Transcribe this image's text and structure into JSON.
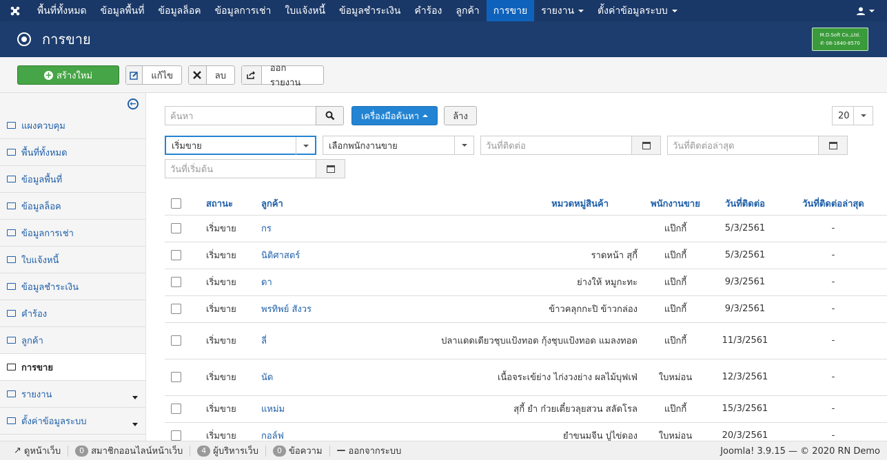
{
  "nav": {
    "items": [
      "พื้นที่ทั้งหมด",
      "ข้อมูลพื้นที่",
      "ข้อมูลล็อค",
      "ข้อมูลการเช่า",
      "ใบแจ้งหนี้",
      "ข้อมูลชำระเงิน",
      "คำร้อง",
      "ลูกค้า",
      "การขาย",
      "รายงาน",
      "ตั้งค่าข้อมูลระบบ"
    ],
    "active": "การขาย"
  },
  "header": {
    "title": "การขาย",
    "brand_line1": "M.D.Soft Co.,Ltd.",
    "brand_line2": "08-1640-8570"
  },
  "toolbar": {
    "new": "สร้างใหม่",
    "edit": "แก้ไข",
    "delete": "ลบ",
    "export": "ออกรายงาน"
  },
  "sidebar": {
    "items": [
      "แผงควบคุม",
      "พื้นที่ทั้งหมด",
      "ข้อมูลพื้นที่",
      "ข้อมูลล็อค",
      "ข้อมูลการเช่า",
      "ใบแจ้งหนี้",
      "ข้อมูลชำระเงิน",
      "คำร้อง",
      "ลูกค้า",
      "การขาย",
      "รายงาน",
      "ตั้งค่าข้อมูลระบบ"
    ]
  },
  "filters": {
    "search_placeholder": "ค้นหา",
    "tools": "เครื่องมือค้นหา",
    "clear": "ล้าง",
    "limit": "20",
    "status": "เริ่มขาย",
    "employee": "เลือกพนักงานขาย",
    "contact_date": "วันที่ติดต่อ",
    "last_contact": "วันที่ติดต่อล่าสุด",
    "start_date": "วันที่เริ่มต้น"
  },
  "table": {
    "headers": [
      "สถานะ",
      "ลูกค้า",
      "หมวดหมู่สินค้า",
      "พนักงานขาย",
      "วันที่ติดต่อ",
      "วันที่ติดต่อล่าสุด"
    ],
    "rows": [
      [
        "เริ่มขาย",
        "กร",
        "",
        "แป๊กกี้",
        "5/3/2561",
        "-"
      ],
      [
        "เริ่มขาย",
        "นิติศาสตร์",
        "ราดหน้า สุกี้",
        "แป๊กกี้",
        "5/3/2561",
        "-"
      ],
      [
        "เริ่มขาย",
        "ดา",
        "ย่างให้ หมูกะทะ",
        "แป๊กกี้",
        "9/3/2561",
        "-"
      ],
      [
        "เริ่มขาย",
        "พรทิพย์ สังวร",
        "ข้าวคลุกกะปิ ข้าวกล่อง",
        "แป๊กกี้",
        "9/3/2561",
        "-"
      ],
      [
        "เริ่มขาย",
        "ลี่",
        "ปลาแดดเดียวชุบแป้งทอด กุ้งชุบแป้งทอด แมลงทอด",
        "แป๊กกี้",
        "11/3/2561",
        "-"
      ],
      [
        "เริ่มขาย",
        "นัด",
        "เนื้อจระเข้ย่าง ไก่งวงย่าง ผลไม้บุฟเฟ่",
        "ใบหม่อน",
        "12/3/2561",
        "-"
      ],
      [
        "เริ่มขาย",
        "แหม่ม",
        "สุกี้ ยำ ก๋วยเตี๋ยวลุยสวน สลัดโรล",
        "แป๊กกี้",
        "15/3/2561",
        "-"
      ],
      [
        "เริ่มขาย",
        "กอล์ฟ",
        "ยำขนมจีน ปูไข่ดอง",
        "ใบหม่อน",
        "20/3/2561",
        "-"
      ]
    ]
  },
  "footer": {
    "view_site": "ดูหน้าเว็บ",
    "visitors_count": "0",
    "visitors": "สมาชิกออนไลน์หน้าเว็บ",
    "admins_count": "4",
    "admins": "ผู้บริหารเว็บ",
    "messages_count": "0",
    "messages": "ข้อความ",
    "logout": "ออกจากระบบ",
    "version": "Joomla! 3.9.15 — © 2020 RN Demo"
  }
}
